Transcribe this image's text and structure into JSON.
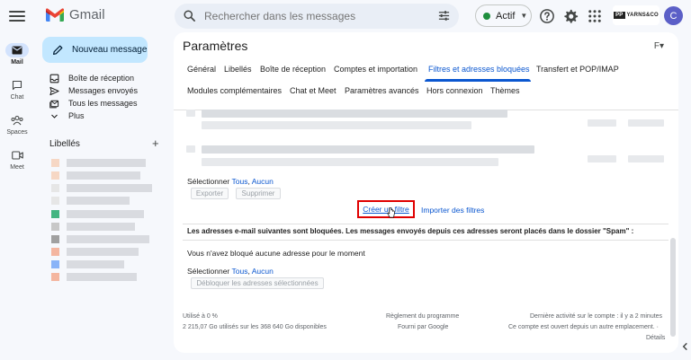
{
  "app": {
    "name": "Gmail"
  },
  "search": {
    "placeholder": "Rechercher dans les messages"
  },
  "status": {
    "label": "Actif",
    "color": "#1e8e3e"
  },
  "brand": {
    "prefix": "PP",
    "name": "YARNS&CO"
  },
  "account": {
    "initial": "C"
  },
  "rail": [
    {
      "label": "Mail",
      "icon": "mail-icon"
    },
    {
      "label": "Chat",
      "icon": "chat-icon"
    },
    {
      "label": "Spaces",
      "icon": "spaces-icon"
    },
    {
      "label": "Meet",
      "icon": "meet-icon"
    }
  ],
  "compose": {
    "label": "Nouveau message"
  },
  "nav": [
    {
      "label": "Boîte de réception",
      "icon": "inbox-icon"
    },
    {
      "label": "Messages envoyés",
      "icon": "send-icon"
    },
    {
      "label": "Tous les messages",
      "icon": "all-mail-icon"
    },
    {
      "label": "Plus",
      "icon": "chevron-down-icon"
    }
  ],
  "labels": {
    "title": "Libellés",
    "add": "+"
  },
  "settings": {
    "title": "Paramètres",
    "language": "F▾",
    "tabs_row1": [
      "Général",
      "Libellés",
      "Boîte de réception",
      "Comptes et importation",
      "Filtres et adresses bloquées",
      "Transfert et POP/IMAP"
    ],
    "tabs_row2": [
      "Modules complémentaires",
      "Chat et Meet",
      "Paramètres avancés",
      "Hors connexion",
      "Thèmes"
    ],
    "filters": {
      "select_prefix": "Sélectionner",
      "select_all": "Tous",
      "select_none": "Aucun",
      "export": "Exporter",
      "delete": "Supprimer",
      "create_filter": "Créer un filtre",
      "import_filters": "Importer des filtres"
    },
    "blocked": {
      "title": "Les adresses e-mail suivantes sont bloquées. Les messages envoyés depuis ces adresses seront placés dans le dossier \"Spam\" :",
      "empty": "Vous n'avez bloqué aucune adresse pour le moment",
      "select_prefix": "Sélectionner",
      "select_all": "Tous",
      "select_none": "Aucun",
      "unblock": "Débloquer les adresses sélectionnées"
    },
    "footer": {
      "usage": "Utilisé à 0 %",
      "storage": "2 215,07 Go utilisés sur les 368 640 Go disponibles",
      "policy": "Règlement du programme",
      "provider": "Fourni par Google",
      "activity": "Dernière activité sur le compte : il y a 2 minutes",
      "open_elsewhere": "Ce compte est ouvert depuis un autre emplacement. ·",
      "details": "Détails"
    }
  }
}
